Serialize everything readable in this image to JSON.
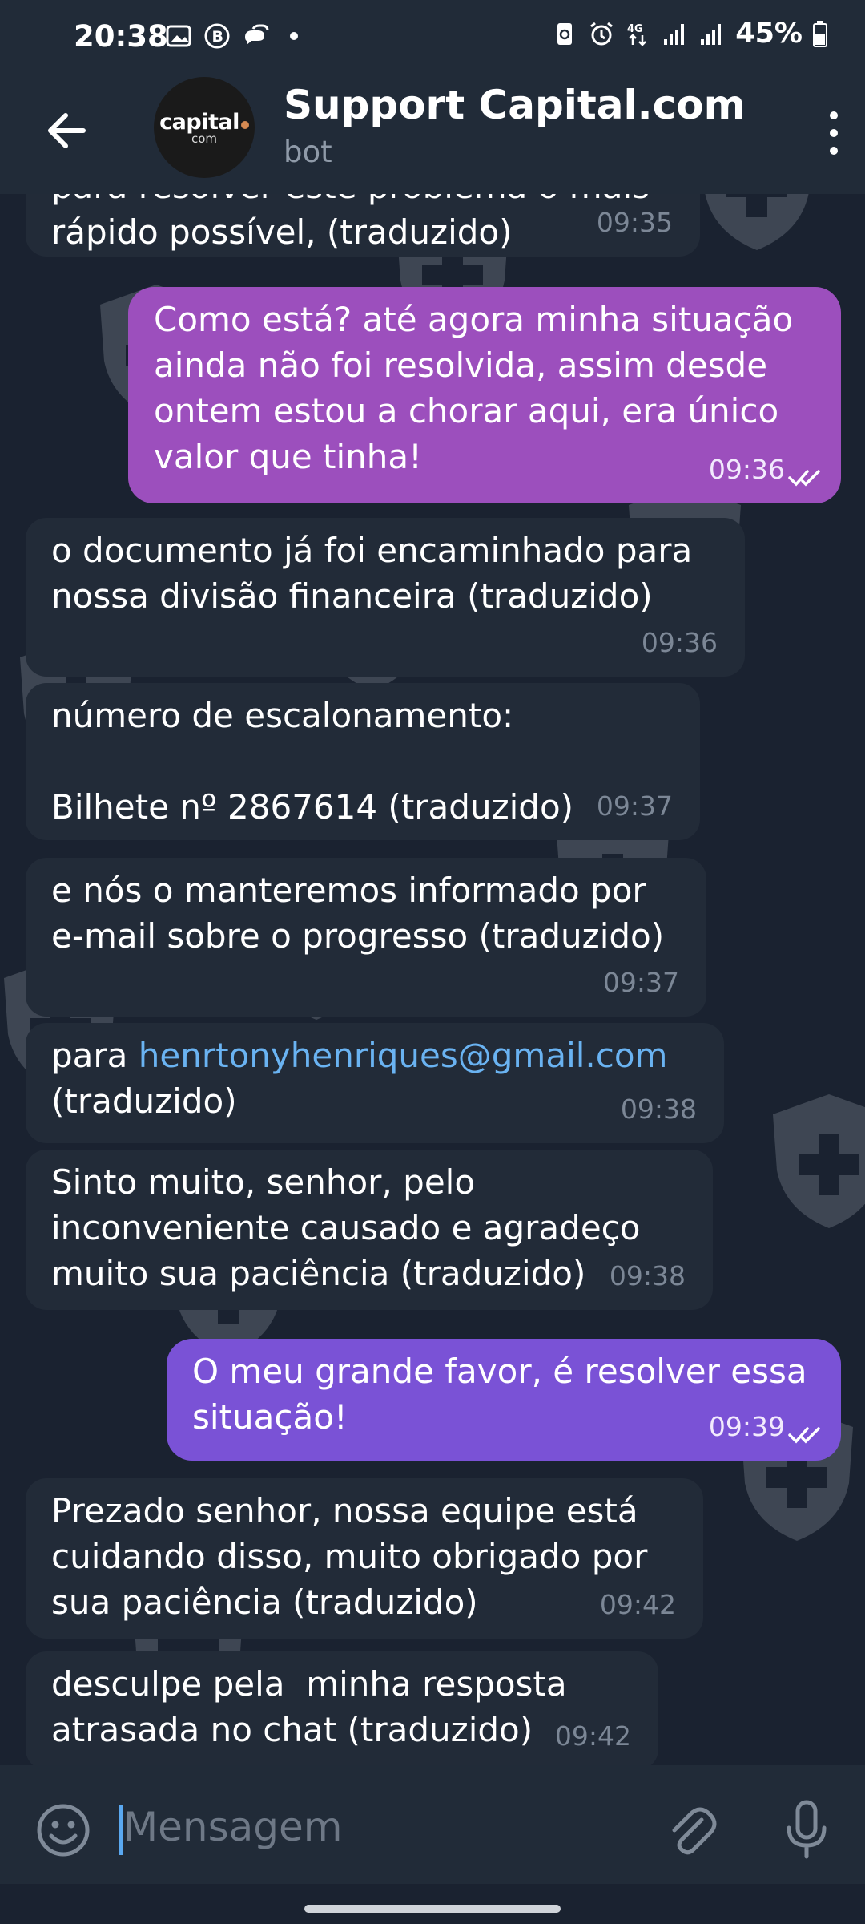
{
  "status_bar": {
    "time": "20:38",
    "battery": "45%",
    "network": "4G",
    "icons_left": [
      "gallery-icon",
      "b-badge-icon",
      "chat-bubbles-icon",
      "dot-icon"
    ],
    "icons_right": [
      "recycle-icon",
      "alarm-icon",
      "network-4g-icon",
      "signal-icon",
      "signal-icon",
      "battery-icon"
    ]
  },
  "header": {
    "title": "Support Capital.com",
    "subtitle": "bot",
    "avatar_brand": "capital",
    "avatar_domain": "com"
  },
  "messages": [
    {
      "dir": "in",
      "lines": [
        "para resolver este problema o mais",
        "rápido possível, (traduzido)"
      ],
      "time": "09:35"
    },
    {
      "dir": "out",
      "lines": [
        "Como está? até agora minha situação",
        "ainda não foi resolvida, assim desde",
        "ontem estou a chorar aqui, era único",
        "valor que tinha!"
      ],
      "time": "09:36",
      "ticks": "double-check-icon"
    },
    {
      "dir": "in",
      "lines": [
        "o documento já foi encaminhado para",
        "nossa divisão financeira (traduzido)"
      ],
      "time": "09:36"
    },
    {
      "dir": "in",
      "lines": [
        "número de escalonamento:",
        "",
        "Bilhete nº 2867614 (traduzido)"
      ],
      "time": "09:37"
    },
    {
      "dir": "in",
      "lines": [
        "e nós o manteremos informado por",
        "e-mail sobre o progresso (traduzido)"
      ],
      "time": "09:37"
    },
    {
      "dir": "in",
      "prefix": "para ",
      "link": "henrtonyhenriques@gmail.com",
      "lines": [
        "(traduzido)"
      ],
      "time": "09:38"
    },
    {
      "dir": "in",
      "lines": [
        "Sinto muito, senhor, pelo",
        "inconveniente causado e agradeço",
        "muito sua paciência (traduzido)"
      ],
      "time": "09:38"
    },
    {
      "dir": "out",
      "lines": [
        "O meu grande favor, é resolver essa",
        "situação!"
      ],
      "time": "09:39",
      "ticks": "double-check-icon"
    },
    {
      "dir": "in",
      "lines": [
        "Prezado senhor, nossa equipe está",
        "cuidando disso, muito obrigado por",
        "sua paciência (traduzido)"
      ],
      "time": "09:42"
    },
    {
      "dir": "in",
      "lines": [
        "desculpe pela  minha resposta",
        "atrasada no chat (traduzido)"
      ],
      "time": "09:42"
    }
  ],
  "input": {
    "placeholder": "Mensagem"
  },
  "colors": {
    "background": "#1a2230",
    "bar": "#212b38",
    "incoming_bubble": "#222b38",
    "outgoing_bubble_1": "#9c4fbd",
    "outgoing_bubble_2": "#7a52d6",
    "link": "#6ab3f2"
  }
}
